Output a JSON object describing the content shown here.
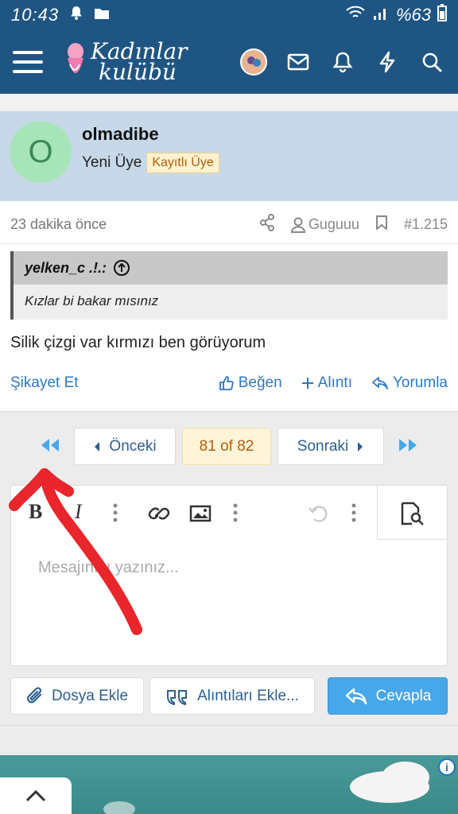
{
  "status_bar": {
    "time": "10:43",
    "battery": "%63"
  },
  "header": {
    "logo_line1": "Kadınlar",
    "logo_line2": "kulübü",
    "brand_color": "#1f5582",
    "icons": [
      "menu-icon",
      "avatar",
      "envelope-icon",
      "bell-icon",
      "bolt-icon",
      "search-icon"
    ]
  },
  "post": {
    "author": {
      "initial": "O",
      "name": "olmadibe",
      "title": "Yeni Üye",
      "badge": "Kayıtlı Üye"
    },
    "time_ago": "23 dakika önce",
    "mentioned_user": "Guguuu",
    "post_number": "#1.215",
    "quote": {
      "author": "yelken_c .!.:",
      "text": "Kızlar bi bakar mısınız"
    },
    "body": "Silik çizgi var kırmızı ben görüyorum",
    "actions": {
      "report": "Şikayet Et",
      "like": "Beğen",
      "quote": "Alıntı",
      "reply": "Yorumla"
    }
  },
  "pagination": {
    "prev": "Önceki",
    "current": "81 of 82",
    "next": "Sonraki"
  },
  "editor": {
    "placeholder": "Mesajınızı yazınız...",
    "bold": "B",
    "italic": "I"
  },
  "buttons": {
    "attach": "Dosya Ekle",
    "insert_quotes": "Alıntıları Ekle...",
    "reply": "Cevapla"
  },
  "ad": {
    "info_symbol": "i"
  },
  "colors": {
    "accent_blue": "#2c79c1",
    "primary_button": "#47a7eb",
    "badge_text": "#b35f0b",
    "annotation_arrow": "#e8262b"
  }
}
